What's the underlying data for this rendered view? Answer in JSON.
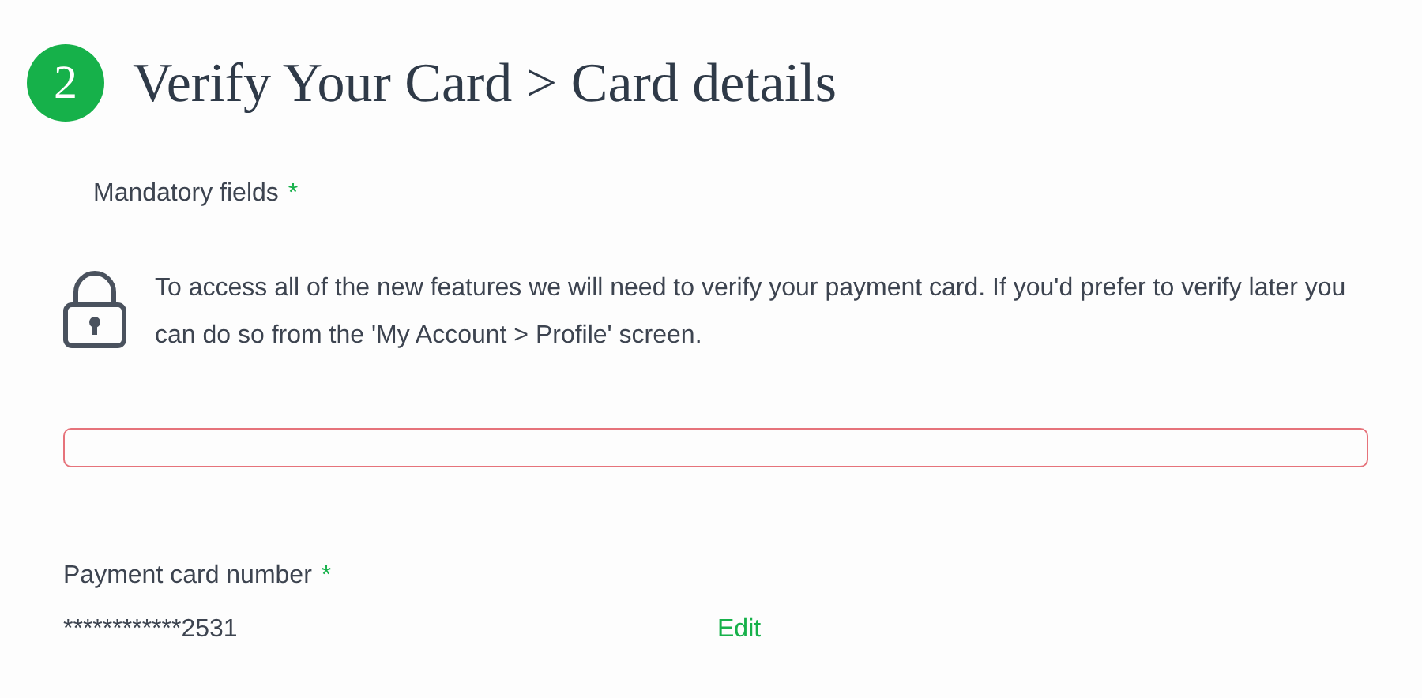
{
  "header": {
    "step": "2",
    "title": "Verify Your Card > Card details"
  },
  "mandatory": {
    "label": "Mandatory fields",
    "asterisk": "*"
  },
  "notice": {
    "text": "To access all of the new features we will need to verify your payment card. If you'd prefer to verify later you can do so from the 'My Account > Profile' screen."
  },
  "alert_box": {
    "error": true
  },
  "card": {
    "label": "Payment card number",
    "asterisk": "*",
    "value": "************2531",
    "action": "Edit"
  }
}
